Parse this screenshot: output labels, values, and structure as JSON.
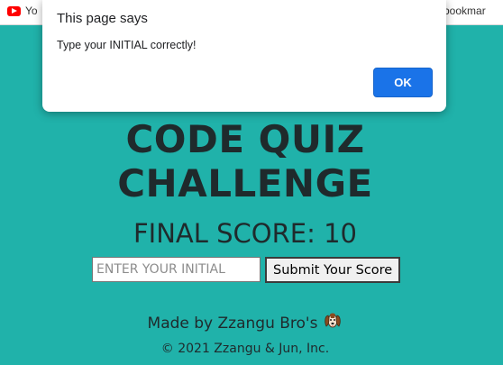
{
  "browser": {
    "bookmarks": {
      "youtube_label": "Yo",
      "youtube_icon": "youtube-icon",
      "other_label": "er bookmar"
    }
  },
  "alert": {
    "title": "This page says",
    "message": "Type your INITIAL correctly!",
    "ok_label": "OK",
    "ok_color": "#1a73e8"
  },
  "page": {
    "background_color": "#20b2aa",
    "title": "CODE QUIZ CHALLENGE",
    "final_score": "FINAL SCORE: 10",
    "form": {
      "initial_placeholder": "ENTER YOUR INITIAL",
      "initial_value": "",
      "submit_label": "Submit Your Score"
    },
    "credits": "Made by Zzangu Bro's",
    "credits_icon": "dog-face-icon",
    "copyright": "© 2021 Zzangu & Jun, Inc."
  }
}
